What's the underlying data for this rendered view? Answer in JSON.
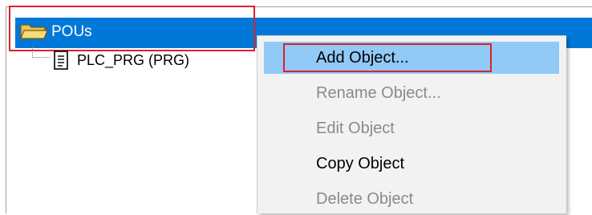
{
  "tree": {
    "root": {
      "label": "POUs",
      "icon": "folder-open-icon"
    },
    "child": {
      "label": "PLC_PRG (PRG)",
      "icon": "document-icon"
    }
  },
  "context_menu": {
    "items": [
      {
        "label": "Add Object...",
        "enabled": true,
        "hover": true
      },
      {
        "label": "Rename Object...",
        "enabled": false
      },
      {
        "label": "Edit Object",
        "enabled": false
      },
      {
        "label": "Copy Object",
        "enabled": true
      },
      {
        "label": "Delete Object",
        "enabled": false
      }
    ]
  },
  "colors": {
    "selection": "#0078d7",
    "menu_hover": "#91c9f7",
    "annotation_box": "#e0202b",
    "disabled_text": "#8a8a8a"
  }
}
